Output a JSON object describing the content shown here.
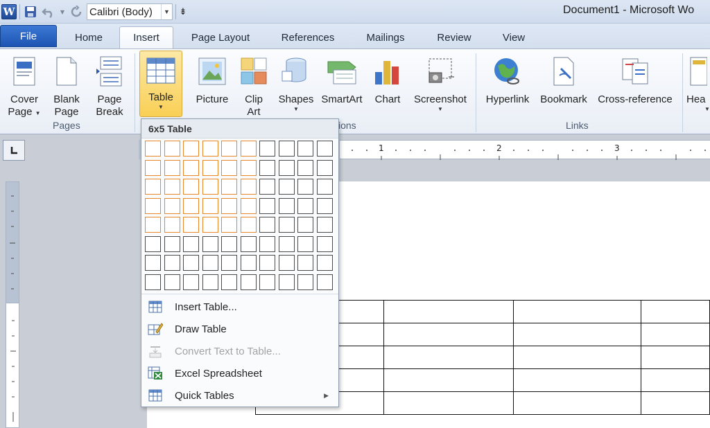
{
  "window": {
    "title": "Document1 - Microsoft Wo"
  },
  "qat": {
    "app_icon_letter": "W",
    "font_name": "Calibri (Body)"
  },
  "tabs": [
    {
      "id": "file",
      "label": "File"
    },
    {
      "id": "home",
      "label": "Home"
    },
    {
      "id": "insert",
      "label": "Insert"
    },
    {
      "id": "page-layout",
      "label": "Page Layout"
    },
    {
      "id": "references",
      "label": "References"
    },
    {
      "id": "mailings",
      "label": "Mailings"
    },
    {
      "id": "review",
      "label": "Review"
    },
    {
      "id": "view",
      "label": "View"
    }
  ],
  "ribbon": {
    "cover_page": [
      "Cover",
      "Page"
    ],
    "blank_page": [
      "Blank",
      "Page"
    ],
    "page_break": [
      "Page",
      "Break"
    ],
    "table": "Table",
    "picture": "Picture",
    "clip_art": [
      "Clip",
      "Art"
    ],
    "shapes": "Shapes",
    "smartart": "SmartArt",
    "chart": "Chart",
    "screenshot": "Screenshot",
    "hyperlink": "Hyperlink",
    "bookmark": "Bookmark",
    "cross_reference": "Cross-reference",
    "header": "Hea",
    "groups": {
      "pages": "Pages",
      "illustrations": "ions",
      "links": "Links"
    }
  },
  "table_dropdown": {
    "header": "6x5 Table",
    "grid": {
      "cols": 10,
      "rows": 8,
      "hl_cols": 6,
      "hl_rows": 5
    },
    "menu": [
      {
        "label": "Insert Table...",
        "icon": "insert-table-icon",
        "disabled": false
      },
      {
        "label": "Draw Table",
        "icon": "draw-table-icon",
        "disabled": false
      },
      {
        "label": "Convert Text to Table...",
        "icon": "convert-text-icon",
        "disabled": true
      },
      {
        "label": "Excel Spreadsheet",
        "icon": "excel-spreadsheet-icon",
        "disabled": false
      },
      {
        "label": "Quick Tables",
        "icon": "quick-tables-icon",
        "disabled": false
      }
    ]
  },
  "ruler": {
    "marks": [
      "1",
      "2",
      "3"
    ]
  },
  "colors": {
    "highlight": "#e8872a",
    "selected_button": "#f9cf55",
    "file_tab": "#1d55b3"
  }
}
